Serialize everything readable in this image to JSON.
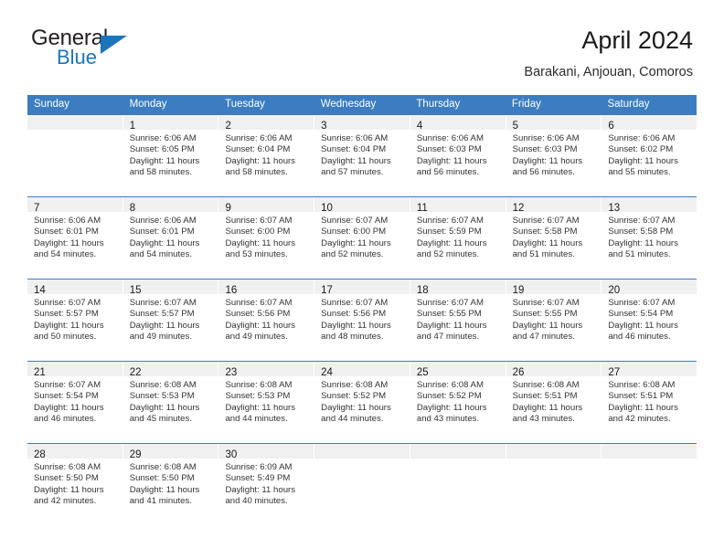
{
  "brand": {
    "name_part1": "General",
    "name_part2": "Blue",
    "accent_color": "#1b75bb"
  },
  "header": {
    "title": "April 2024",
    "subtitle": "Barakani, Anjouan, Comoros"
  },
  "calendar": {
    "header_bg": "#3b7dc0",
    "daynum_band_bg": "#f0f0f0",
    "weekday_headers": [
      "Sunday",
      "Monday",
      "Tuesday",
      "Wednesday",
      "Thursday",
      "Friday",
      "Saturday"
    ],
    "weeks": [
      [
        {
          "day": "",
          "sunrise": "",
          "sunset": "",
          "daylight_line1": "",
          "daylight_line2": ""
        },
        {
          "day": "1",
          "sunrise": "Sunrise: 6:06 AM",
          "sunset": "Sunset: 6:05 PM",
          "daylight_line1": "Daylight: 11 hours",
          "daylight_line2": "and 58 minutes."
        },
        {
          "day": "2",
          "sunrise": "Sunrise: 6:06 AM",
          "sunset": "Sunset: 6:04 PM",
          "daylight_line1": "Daylight: 11 hours",
          "daylight_line2": "and 58 minutes."
        },
        {
          "day": "3",
          "sunrise": "Sunrise: 6:06 AM",
          "sunset": "Sunset: 6:04 PM",
          "daylight_line1": "Daylight: 11 hours",
          "daylight_line2": "and 57 minutes."
        },
        {
          "day": "4",
          "sunrise": "Sunrise: 6:06 AM",
          "sunset": "Sunset: 6:03 PM",
          "daylight_line1": "Daylight: 11 hours",
          "daylight_line2": "and 56 minutes."
        },
        {
          "day": "5",
          "sunrise": "Sunrise: 6:06 AM",
          "sunset": "Sunset: 6:03 PM",
          "daylight_line1": "Daylight: 11 hours",
          "daylight_line2": "and 56 minutes."
        },
        {
          "day": "6",
          "sunrise": "Sunrise: 6:06 AM",
          "sunset": "Sunset: 6:02 PM",
          "daylight_line1": "Daylight: 11 hours",
          "daylight_line2": "and 55 minutes."
        }
      ],
      [
        {
          "day": "7",
          "sunrise": "Sunrise: 6:06 AM",
          "sunset": "Sunset: 6:01 PM",
          "daylight_line1": "Daylight: 11 hours",
          "daylight_line2": "and 54 minutes."
        },
        {
          "day": "8",
          "sunrise": "Sunrise: 6:06 AM",
          "sunset": "Sunset: 6:01 PM",
          "daylight_line1": "Daylight: 11 hours",
          "daylight_line2": "and 54 minutes."
        },
        {
          "day": "9",
          "sunrise": "Sunrise: 6:07 AM",
          "sunset": "Sunset: 6:00 PM",
          "daylight_line1": "Daylight: 11 hours",
          "daylight_line2": "and 53 minutes."
        },
        {
          "day": "10",
          "sunrise": "Sunrise: 6:07 AM",
          "sunset": "Sunset: 6:00 PM",
          "daylight_line1": "Daylight: 11 hours",
          "daylight_line2": "and 52 minutes."
        },
        {
          "day": "11",
          "sunrise": "Sunrise: 6:07 AM",
          "sunset": "Sunset: 5:59 PM",
          "daylight_line1": "Daylight: 11 hours",
          "daylight_line2": "and 52 minutes."
        },
        {
          "day": "12",
          "sunrise": "Sunrise: 6:07 AM",
          "sunset": "Sunset: 5:58 PM",
          "daylight_line1": "Daylight: 11 hours",
          "daylight_line2": "and 51 minutes."
        },
        {
          "day": "13",
          "sunrise": "Sunrise: 6:07 AM",
          "sunset": "Sunset: 5:58 PM",
          "daylight_line1": "Daylight: 11 hours",
          "daylight_line2": "and 51 minutes."
        }
      ],
      [
        {
          "day": "14",
          "sunrise": "Sunrise: 6:07 AM",
          "sunset": "Sunset: 5:57 PM",
          "daylight_line1": "Daylight: 11 hours",
          "daylight_line2": "and 50 minutes."
        },
        {
          "day": "15",
          "sunrise": "Sunrise: 6:07 AM",
          "sunset": "Sunset: 5:57 PM",
          "daylight_line1": "Daylight: 11 hours",
          "daylight_line2": "and 49 minutes."
        },
        {
          "day": "16",
          "sunrise": "Sunrise: 6:07 AM",
          "sunset": "Sunset: 5:56 PM",
          "daylight_line1": "Daylight: 11 hours",
          "daylight_line2": "and 49 minutes."
        },
        {
          "day": "17",
          "sunrise": "Sunrise: 6:07 AM",
          "sunset": "Sunset: 5:56 PM",
          "daylight_line1": "Daylight: 11 hours",
          "daylight_line2": "and 48 minutes."
        },
        {
          "day": "18",
          "sunrise": "Sunrise: 6:07 AM",
          "sunset": "Sunset: 5:55 PM",
          "daylight_line1": "Daylight: 11 hours",
          "daylight_line2": "and 47 minutes."
        },
        {
          "day": "19",
          "sunrise": "Sunrise: 6:07 AM",
          "sunset": "Sunset: 5:55 PM",
          "daylight_line1": "Daylight: 11 hours",
          "daylight_line2": "and 47 minutes."
        },
        {
          "day": "20",
          "sunrise": "Sunrise: 6:07 AM",
          "sunset": "Sunset: 5:54 PM",
          "daylight_line1": "Daylight: 11 hours",
          "daylight_line2": "and 46 minutes."
        }
      ],
      [
        {
          "day": "21",
          "sunrise": "Sunrise: 6:07 AM",
          "sunset": "Sunset: 5:54 PM",
          "daylight_line1": "Daylight: 11 hours",
          "daylight_line2": "and 46 minutes."
        },
        {
          "day": "22",
          "sunrise": "Sunrise: 6:08 AM",
          "sunset": "Sunset: 5:53 PM",
          "daylight_line1": "Daylight: 11 hours",
          "daylight_line2": "and 45 minutes."
        },
        {
          "day": "23",
          "sunrise": "Sunrise: 6:08 AM",
          "sunset": "Sunset: 5:53 PM",
          "daylight_line1": "Daylight: 11 hours",
          "daylight_line2": "and 44 minutes."
        },
        {
          "day": "24",
          "sunrise": "Sunrise: 6:08 AM",
          "sunset": "Sunset: 5:52 PM",
          "daylight_line1": "Daylight: 11 hours",
          "daylight_line2": "and 44 minutes."
        },
        {
          "day": "25",
          "sunrise": "Sunrise: 6:08 AM",
          "sunset": "Sunset: 5:52 PM",
          "daylight_line1": "Daylight: 11 hours",
          "daylight_line2": "and 43 minutes."
        },
        {
          "day": "26",
          "sunrise": "Sunrise: 6:08 AM",
          "sunset": "Sunset: 5:51 PM",
          "daylight_line1": "Daylight: 11 hours",
          "daylight_line2": "and 43 minutes."
        },
        {
          "day": "27",
          "sunrise": "Sunrise: 6:08 AM",
          "sunset": "Sunset: 5:51 PM",
          "daylight_line1": "Daylight: 11 hours",
          "daylight_line2": "and 42 minutes."
        }
      ],
      [
        {
          "day": "28",
          "sunrise": "Sunrise: 6:08 AM",
          "sunset": "Sunset: 5:50 PM",
          "daylight_line1": "Daylight: 11 hours",
          "daylight_line2": "and 42 minutes."
        },
        {
          "day": "29",
          "sunrise": "Sunrise: 6:08 AM",
          "sunset": "Sunset: 5:50 PM",
          "daylight_line1": "Daylight: 11 hours",
          "daylight_line2": "and 41 minutes."
        },
        {
          "day": "30",
          "sunrise": "Sunrise: 6:09 AM",
          "sunset": "Sunset: 5:49 PM",
          "daylight_line1": "Daylight: 11 hours",
          "daylight_line2": "and 40 minutes."
        },
        {
          "day": "",
          "sunrise": "",
          "sunset": "",
          "daylight_line1": "",
          "daylight_line2": ""
        },
        {
          "day": "",
          "sunrise": "",
          "sunset": "",
          "daylight_line1": "",
          "daylight_line2": ""
        },
        {
          "day": "",
          "sunrise": "",
          "sunset": "",
          "daylight_line1": "",
          "daylight_line2": ""
        },
        {
          "day": "",
          "sunrise": "",
          "sunset": "",
          "daylight_line1": "",
          "daylight_line2": ""
        }
      ]
    ]
  }
}
